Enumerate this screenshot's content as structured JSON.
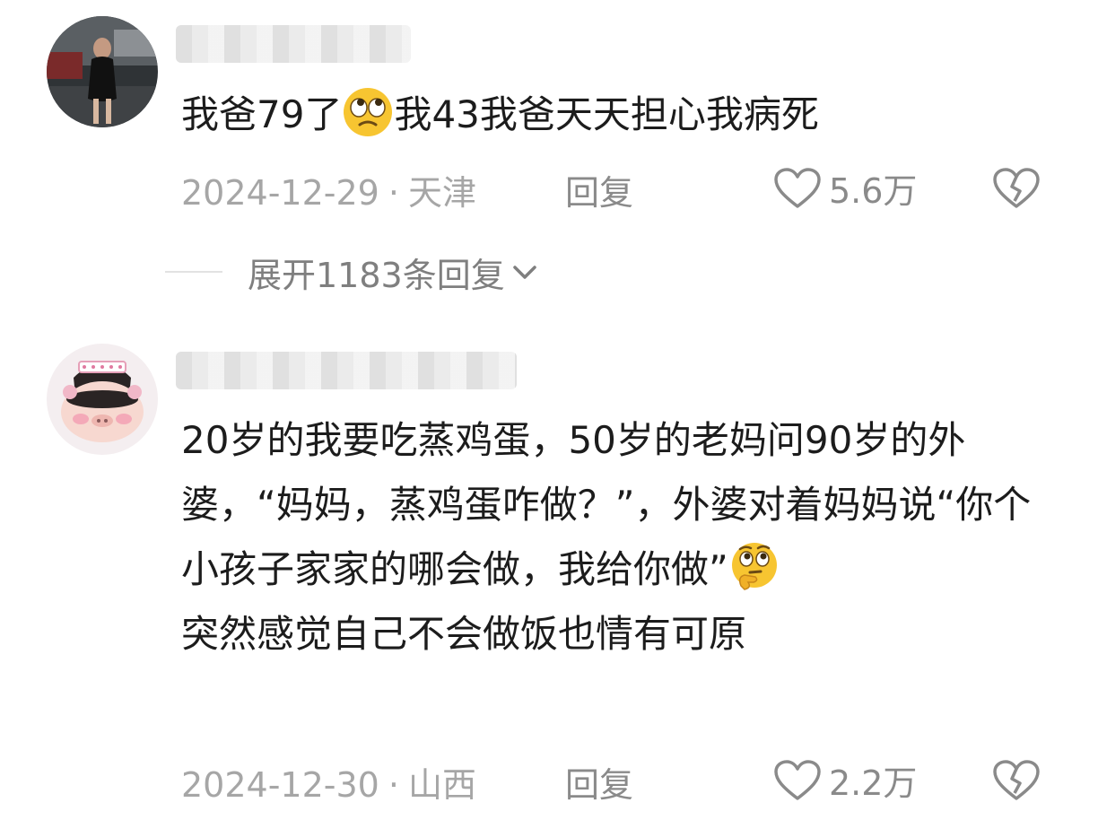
{
  "comments": [
    {
      "text_before_emoji": "我爸79了",
      "emoji": "eye-roll-emoji",
      "text_after_emoji": "我43我爸天天担心我病死",
      "date": "2024-12-29",
      "separator": "·",
      "location": "天津",
      "reply_label": "回复",
      "likes": "5.6万",
      "expand_replies": "展开1183条回复"
    },
    {
      "text_part1": "20岁的我要吃蒸鸡蛋，50岁的老妈问90岁的外婆，“妈妈，蒸鸡蛋咋做？”，外婆对着妈妈说“你个小孩子家家的哪会做，我给你做”",
      "emoji": "thinking-emoji",
      "text_part2": "\n突然感觉自己不会做饭也情有可原",
      "date": "2024-12-30",
      "separator": "·",
      "location": "山西",
      "reply_label": "回复",
      "likes": "2.2万"
    }
  ],
  "icons": {
    "like": "heart-outline-icon",
    "dislike": "broken-heart-icon",
    "expand": "chevron-down-icon"
  },
  "colors": {
    "text": "#1c1c1c",
    "meta": "#a6a6a6",
    "action": "#8a8a8a",
    "emoji_face": "#f7c531"
  }
}
